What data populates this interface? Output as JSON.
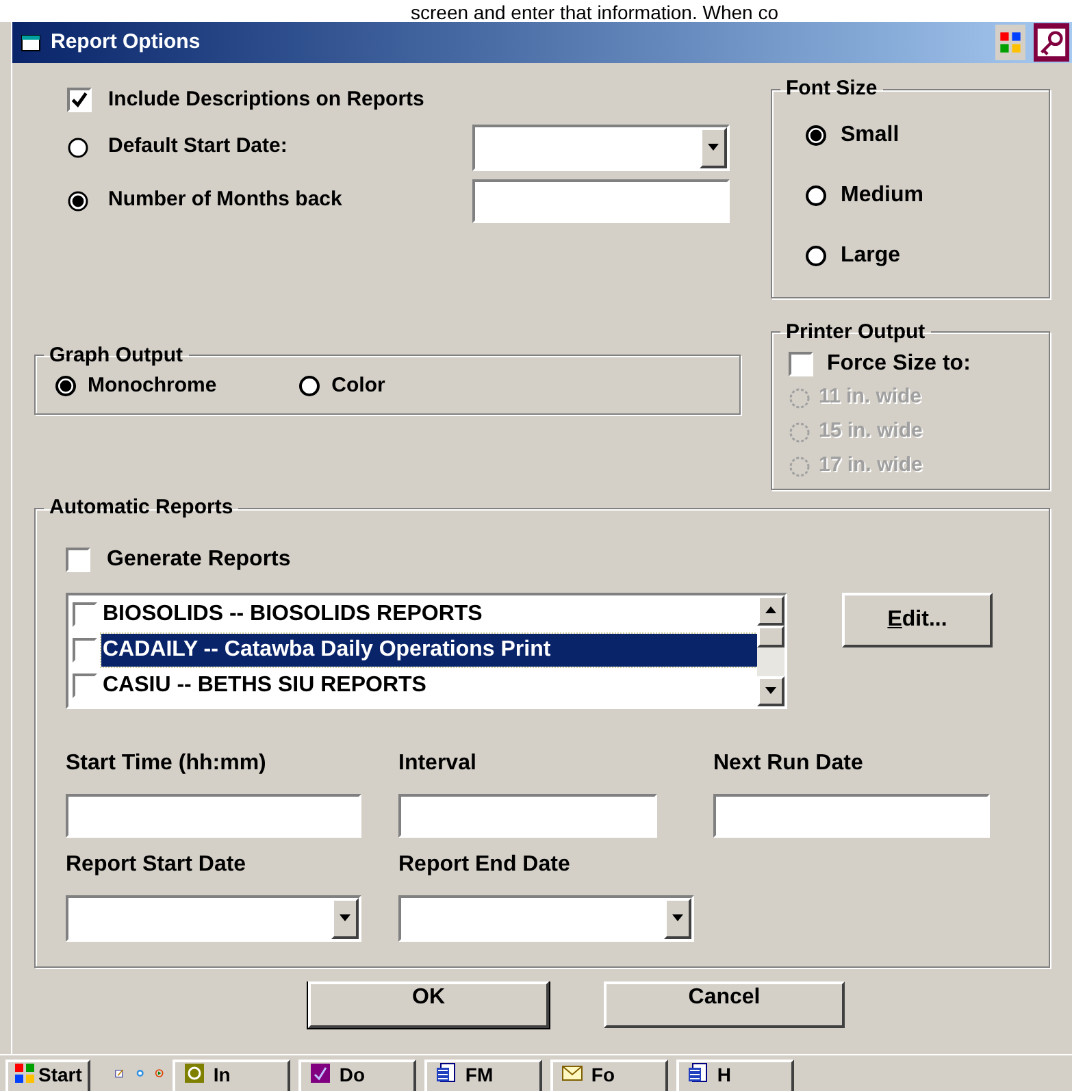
{
  "background_text": "screen and enter that information. When co",
  "window": {
    "title": "Report Options"
  },
  "include_descriptions": {
    "label": "Include Descriptions on Reports",
    "checked": true
  },
  "start_options": [
    {
      "label": "Default Start Date:",
      "selected": false,
      "kind": "dropdown"
    },
    {
      "label": "Number of Months back",
      "selected": true,
      "kind": "field"
    }
  ],
  "font_size": {
    "title": "Font Size",
    "options": [
      {
        "label": "Small",
        "selected": true
      },
      {
        "label": "Medium",
        "selected": false
      },
      {
        "label": "Large",
        "selected": false
      }
    ]
  },
  "printer_output": {
    "title": "Printer Output",
    "force_size": {
      "label": "Force Size to:",
      "checked": false
    },
    "options": [
      {
        "label": "11 in. wide",
        "selected": false,
        "disabled": true
      },
      {
        "label": "15 in. wide",
        "selected": false,
        "disabled": true
      },
      {
        "label": "17 in. wide",
        "selected": false,
        "disabled": true
      }
    ]
  },
  "graph_output": {
    "title": "Graph Output",
    "options": [
      {
        "label": "Monochrome",
        "selected": true
      },
      {
        "label": "Color",
        "selected": false
      }
    ]
  },
  "automatic_reports": {
    "title": "Automatic Reports",
    "generate": {
      "label": "Generate Reports",
      "checked": false
    },
    "reports": [
      {
        "label": "BIOSOLIDS -- BIOSOLIDS REPORTS",
        "checked": false,
        "selected": false
      },
      {
        "label": "CADAILY -- Catawba Daily Operations Print",
        "checked": false,
        "selected": true
      },
      {
        "label": "CASIU -- BETHS SIU REPORTS",
        "checked": false,
        "selected": false
      }
    ],
    "edit_button": "Edit...",
    "fields": [
      {
        "label": "Start Time (hh:mm)",
        "kind": "field"
      },
      {
        "label": "Interval",
        "kind": "field"
      },
      {
        "label": "Next Run Date",
        "kind": "field"
      },
      {
        "label": "Report Start Date",
        "kind": "dropdown"
      },
      {
        "label": "Report End Date",
        "kind": "dropdown"
      }
    ]
  },
  "buttons": [
    "OK",
    "Cancel"
  ],
  "taskbar": {
    "start": "Start",
    "tasks": [
      {
        "label": "In",
        "kind": "clock"
      },
      {
        "label": "Do",
        "kind": "purple"
      },
      {
        "label": "FM",
        "kind": "doc"
      },
      {
        "label": "Fo",
        "kind": "mail"
      },
      {
        "label": "H",
        "kind": "doc"
      }
    ]
  }
}
